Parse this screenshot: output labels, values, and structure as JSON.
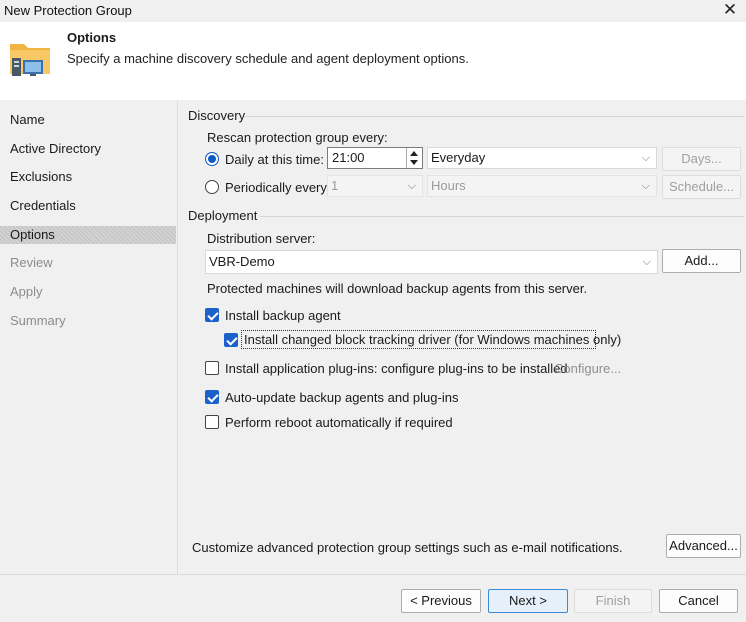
{
  "window": {
    "title": "New Protection Group",
    "close_glyph": "✕"
  },
  "header": {
    "title": "Options",
    "subtitle": "Specify a machine discovery schedule and agent deployment options.",
    "icon": "protection-group-folder-computer-icon"
  },
  "nav": {
    "items": [
      {
        "label": "Name",
        "state": "normal"
      },
      {
        "label": "Active Directory",
        "state": "normal"
      },
      {
        "label": "Exclusions",
        "state": "normal"
      },
      {
        "label": "Credentials",
        "state": "normal"
      },
      {
        "label": "Options",
        "state": "active"
      },
      {
        "label": "Review",
        "state": "disabled"
      },
      {
        "label": "Apply",
        "state": "disabled"
      },
      {
        "label": "Summary",
        "state": "disabled"
      }
    ]
  },
  "discovery": {
    "group_label": "Discovery",
    "rescan_label": "Rescan protection group every:",
    "daily": {
      "label": "Daily at this time:",
      "selected": true,
      "time": "21:00",
      "days_value": "Everyday",
      "days_button": "Days..."
    },
    "periodic": {
      "label": "Periodically every:",
      "selected": false,
      "value": "1",
      "unit": "Hours",
      "schedule_button": "Schedule..."
    }
  },
  "deployment": {
    "group_label": "Deployment",
    "dist_label": "Distribution server:",
    "server": "VBR-Demo",
    "add_button": "Add...",
    "note": "Protected machines will download backup agents from this server.",
    "install_agent": {
      "label": "Install backup agent",
      "checked": true
    },
    "install_cbt": {
      "label": "Install changed block tracking driver (for Windows machines only)",
      "checked": true
    },
    "install_plugins": {
      "label": "Install application plug-ins: configure plug-ins to be installed",
      "checked": false,
      "link": "Configure..."
    },
    "auto_update": {
      "label": "Auto-update backup agents and plug-ins",
      "checked": true
    },
    "reboot": {
      "label": "Perform reboot automatically if required",
      "checked": false
    }
  },
  "advanced": {
    "text": "Customize advanced protection group settings such as e-mail notifications.",
    "button": "Advanced..."
  },
  "footer": {
    "previous": "< Previous",
    "next": "Next >",
    "finish": "Finish",
    "cancel": "Cancel"
  },
  "colors": {
    "accent": "#1a62c9",
    "header_bg": "#ffffff",
    "window_bg": "#f0f0f0"
  }
}
